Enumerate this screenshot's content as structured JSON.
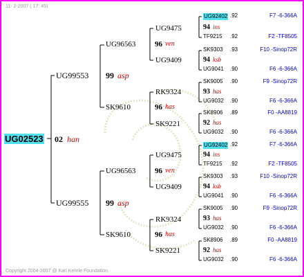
{
  "header": "11- 2-2007 ( 17: 45)",
  "footer": "Copyright 2004-2007 @ Karl Kehrle Foundation.",
  "colors": {
    "frame": "#ff00ff",
    "highlight": "#4fe0f0",
    "italic": "#cc0000",
    "link": "#0000cc",
    "line": "#000000"
  },
  "root": {
    "id": "UG02523",
    "year": "02",
    "name": "han"
  },
  "gen1": [
    {
      "id": "UG99553",
      "year": "99",
      "name": "asp"
    },
    {
      "id": "UG99555",
      "year": "99",
      "name": "asp"
    }
  ],
  "gen2": [
    {
      "id": "UG96563",
      "year": "96",
      "name": "ven"
    },
    {
      "id": "SK9610",
      "year": "96",
      "name": "has"
    },
    {
      "id": "UG96563",
      "year": "96",
      "name": "ven"
    },
    {
      "id": "SK9610",
      "year": "96",
      "name": "has"
    }
  ],
  "gen3": [
    {
      "id": "UG9475",
      "year": "94",
      "name": "ins"
    },
    {
      "id": "UG9409",
      "year": "94",
      "name": "ksb"
    },
    {
      "id": "RK9324",
      "year": "93",
      "name": "has"
    },
    {
      "id": "SK9221",
      "year": "92",
      "name": "has"
    },
    {
      "id": "UG9475",
      "year": "94",
      "name": "ins"
    },
    {
      "id": "UG9409",
      "year": "94",
      "name": "ksb"
    },
    {
      "id": "RK9324",
      "year": "93",
      "name": "has"
    },
    {
      "id": "SK9221",
      "year": "92",
      "name": "has"
    }
  ],
  "gen4": [
    {
      "id": "UG92402",
      "yr": ".92",
      "right": "F7 -6-366A"
    },
    {
      "id": "TF9215",
      "yr": ".92",
      "right": "F2 -TF8505"
    },
    {
      "id": "SK9303",
      "yr": ".93",
      "right": "F10 -Sinop72R"
    },
    {
      "id": "UG9041",
      "yr": ".90",
      "right": "F6 -6-366A"
    },
    {
      "id": "SK9005",
      "yr": ".90",
      "right": "F9 -Sinop72R"
    },
    {
      "id": "UG9032",
      "yr": ".90",
      "right": "F6 -6-366A"
    },
    {
      "id": "SK8906",
      "yr": ".89",
      "right": "F0 -AA8819"
    },
    {
      "id": "UG9032",
      "yr": ".90",
      "right": "F6 -6-366A"
    },
    {
      "id": "UG92402",
      "yr": ".92",
      "right": "F7 -6-366A"
    },
    {
      "id": "TF9215",
      "yr": ".92",
      "right": "F2 -TF8505"
    },
    {
      "id": "SK9303",
      "yr": ".93",
      "right": "F10 -Sinop72R"
    },
    {
      "id": "UG9041",
      "yr": ".90",
      "right": "F6 -6-366A"
    },
    {
      "id": "SK9005",
      "yr": ".90",
      "right": "F9 -Sinop72R"
    },
    {
      "id": "UG9032",
      "yr": ".90",
      "right": "F6 -6-366A"
    },
    {
      "id": "SK8906",
      "yr": ".89",
      "right": "F0 -AA8819"
    },
    {
      "id": "UG9032",
      "yr": ".90",
      "right": "F6 -6-366A"
    }
  ]
}
